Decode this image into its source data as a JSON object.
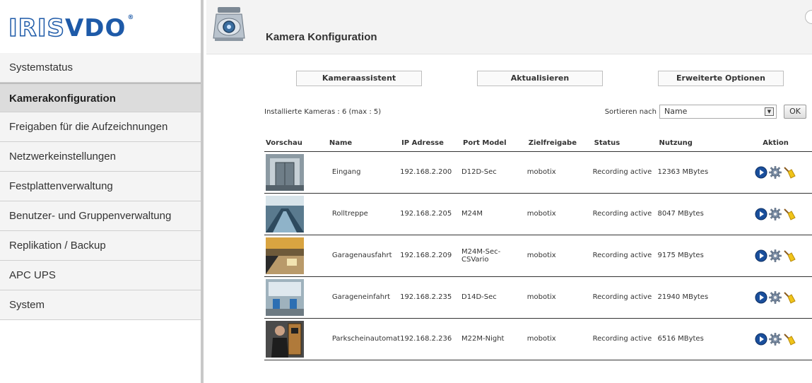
{
  "brand": {
    "logo_outline": "IRIS",
    "logo_solid": "VDO",
    "reg": "®"
  },
  "sidebar": {
    "items": [
      {
        "label": "Systemstatus",
        "active": false
      },
      {
        "label": "Kamerakonfiguration",
        "active": true
      },
      {
        "label": "Freigaben für die Aufzeichnungen",
        "active": false
      },
      {
        "label": "Netzwerkeinstellungen",
        "active": false
      },
      {
        "label": "Festplattenverwaltung",
        "active": false
      },
      {
        "label": "Benutzer- und Gruppenverwaltung",
        "active": false
      },
      {
        "label": "Replikation / Backup",
        "active": false
      },
      {
        "label": "APC UPS",
        "active": false
      },
      {
        "label": "System",
        "active": false
      }
    ]
  },
  "header": {
    "title": "Kamera Konfiguration",
    "icon": "camera-icon"
  },
  "toolbar": {
    "wizard_label": "Kameraassistent",
    "refresh_label": "Aktualisieren",
    "advanced_label": "Erweiterte Optionen"
  },
  "info": {
    "installed": "Installierte Kameras : 6 (max : 5)",
    "sort_label": "Sortieren nach",
    "sort_value": "Name",
    "ok_label": "OK"
  },
  "table": {
    "headers": [
      "Vorschau",
      "Name",
      "IP Adresse",
      "Port Model",
      "Zielfreigabe",
      "Status",
      "Nutzung",
      "Aktion"
    ],
    "rows": [
      {
        "name": "Eingang",
        "ip": "192.168.2.200",
        "model": "D12D-Sec",
        "target": "mobotix",
        "status": "Recording active",
        "usage": "12363 MBytes"
      },
      {
        "name": "Rolltreppe",
        "ip": "192.168.2.205",
        "model": "M24M",
        "target": "mobotix",
        "status": "Recording active",
        "usage": "8047 MBytes"
      },
      {
        "name": "Garagenausfahrt",
        "ip": "192.168.2.209",
        "model": "M24M-Sec-CSVario",
        "target": "mobotix",
        "status": "Recording active",
        "usage": "9175 MBytes"
      },
      {
        "name": "Garageneinfahrt",
        "ip": "192.168.2.235",
        "model": "D14D-Sec",
        "target": "mobotix",
        "status": "Recording active",
        "usage": "21940 MBytes"
      },
      {
        "name": "Parkscheinautomat",
        "ip": "192.168.2.236",
        "model": "M22M-Night",
        "target": "mobotix",
        "status": "Recording active",
        "usage": "6516 MBytes"
      }
    ],
    "action_icons": [
      "play-icon",
      "settings-gear-icon",
      "broom-icon"
    ]
  }
}
